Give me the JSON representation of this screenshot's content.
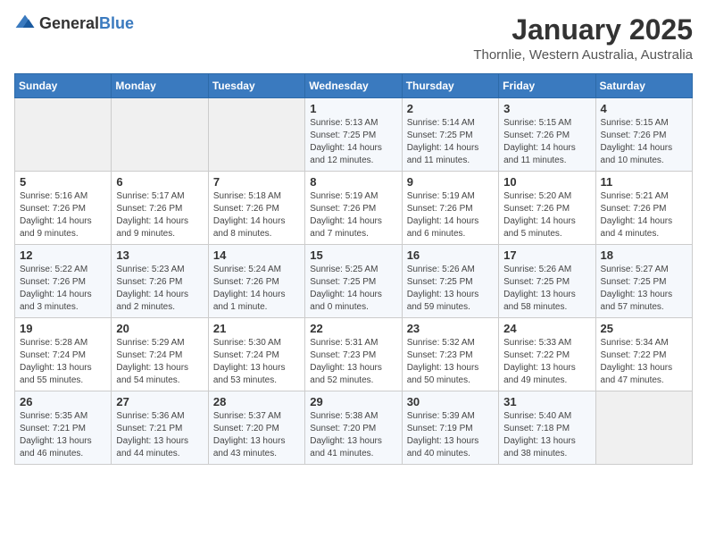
{
  "header": {
    "logo_general": "General",
    "logo_blue": "Blue",
    "title": "January 2025",
    "subtitle": "Thornlie, Western Australia, Australia"
  },
  "calendar": {
    "weekdays": [
      "Sunday",
      "Monday",
      "Tuesday",
      "Wednesday",
      "Thursday",
      "Friday",
      "Saturday"
    ],
    "weeks": [
      [
        {
          "day": "",
          "info": ""
        },
        {
          "day": "",
          "info": ""
        },
        {
          "day": "",
          "info": ""
        },
        {
          "day": "1",
          "info": "Sunrise: 5:13 AM\nSunset: 7:25 PM\nDaylight: 14 hours\nand 12 minutes."
        },
        {
          "day": "2",
          "info": "Sunrise: 5:14 AM\nSunset: 7:25 PM\nDaylight: 14 hours\nand 11 minutes."
        },
        {
          "day": "3",
          "info": "Sunrise: 5:15 AM\nSunset: 7:26 PM\nDaylight: 14 hours\nand 11 minutes."
        },
        {
          "day": "4",
          "info": "Sunrise: 5:15 AM\nSunset: 7:26 PM\nDaylight: 14 hours\nand 10 minutes."
        }
      ],
      [
        {
          "day": "5",
          "info": "Sunrise: 5:16 AM\nSunset: 7:26 PM\nDaylight: 14 hours\nand 9 minutes."
        },
        {
          "day": "6",
          "info": "Sunrise: 5:17 AM\nSunset: 7:26 PM\nDaylight: 14 hours\nand 9 minutes."
        },
        {
          "day": "7",
          "info": "Sunrise: 5:18 AM\nSunset: 7:26 PM\nDaylight: 14 hours\nand 8 minutes."
        },
        {
          "day": "8",
          "info": "Sunrise: 5:19 AM\nSunset: 7:26 PM\nDaylight: 14 hours\nand 7 minutes."
        },
        {
          "day": "9",
          "info": "Sunrise: 5:19 AM\nSunset: 7:26 PM\nDaylight: 14 hours\nand 6 minutes."
        },
        {
          "day": "10",
          "info": "Sunrise: 5:20 AM\nSunset: 7:26 PM\nDaylight: 14 hours\nand 5 minutes."
        },
        {
          "day": "11",
          "info": "Sunrise: 5:21 AM\nSunset: 7:26 PM\nDaylight: 14 hours\nand 4 minutes."
        }
      ],
      [
        {
          "day": "12",
          "info": "Sunrise: 5:22 AM\nSunset: 7:26 PM\nDaylight: 14 hours\nand 3 minutes."
        },
        {
          "day": "13",
          "info": "Sunrise: 5:23 AM\nSunset: 7:26 PM\nDaylight: 14 hours\nand 2 minutes."
        },
        {
          "day": "14",
          "info": "Sunrise: 5:24 AM\nSunset: 7:26 PM\nDaylight: 14 hours\nand 1 minute."
        },
        {
          "day": "15",
          "info": "Sunrise: 5:25 AM\nSunset: 7:25 PM\nDaylight: 14 hours\nand 0 minutes."
        },
        {
          "day": "16",
          "info": "Sunrise: 5:26 AM\nSunset: 7:25 PM\nDaylight: 13 hours\nand 59 minutes."
        },
        {
          "day": "17",
          "info": "Sunrise: 5:26 AM\nSunset: 7:25 PM\nDaylight: 13 hours\nand 58 minutes."
        },
        {
          "day": "18",
          "info": "Sunrise: 5:27 AM\nSunset: 7:25 PM\nDaylight: 13 hours\nand 57 minutes."
        }
      ],
      [
        {
          "day": "19",
          "info": "Sunrise: 5:28 AM\nSunset: 7:24 PM\nDaylight: 13 hours\nand 55 minutes."
        },
        {
          "day": "20",
          "info": "Sunrise: 5:29 AM\nSunset: 7:24 PM\nDaylight: 13 hours\nand 54 minutes."
        },
        {
          "day": "21",
          "info": "Sunrise: 5:30 AM\nSunset: 7:24 PM\nDaylight: 13 hours\nand 53 minutes."
        },
        {
          "day": "22",
          "info": "Sunrise: 5:31 AM\nSunset: 7:23 PM\nDaylight: 13 hours\nand 52 minutes."
        },
        {
          "day": "23",
          "info": "Sunrise: 5:32 AM\nSunset: 7:23 PM\nDaylight: 13 hours\nand 50 minutes."
        },
        {
          "day": "24",
          "info": "Sunrise: 5:33 AM\nSunset: 7:22 PM\nDaylight: 13 hours\nand 49 minutes."
        },
        {
          "day": "25",
          "info": "Sunrise: 5:34 AM\nSunset: 7:22 PM\nDaylight: 13 hours\nand 47 minutes."
        }
      ],
      [
        {
          "day": "26",
          "info": "Sunrise: 5:35 AM\nSunset: 7:21 PM\nDaylight: 13 hours\nand 46 minutes."
        },
        {
          "day": "27",
          "info": "Sunrise: 5:36 AM\nSunset: 7:21 PM\nDaylight: 13 hours\nand 44 minutes."
        },
        {
          "day": "28",
          "info": "Sunrise: 5:37 AM\nSunset: 7:20 PM\nDaylight: 13 hours\nand 43 minutes."
        },
        {
          "day": "29",
          "info": "Sunrise: 5:38 AM\nSunset: 7:20 PM\nDaylight: 13 hours\nand 41 minutes."
        },
        {
          "day": "30",
          "info": "Sunrise: 5:39 AM\nSunset: 7:19 PM\nDaylight: 13 hours\nand 40 minutes."
        },
        {
          "day": "31",
          "info": "Sunrise: 5:40 AM\nSunset: 7:18 PM\nDaylight: 13 hours\nand 38 minutes."
        },
        {
          "day": "",
          "info": ""
        }
      ]
    ]
  }
}
